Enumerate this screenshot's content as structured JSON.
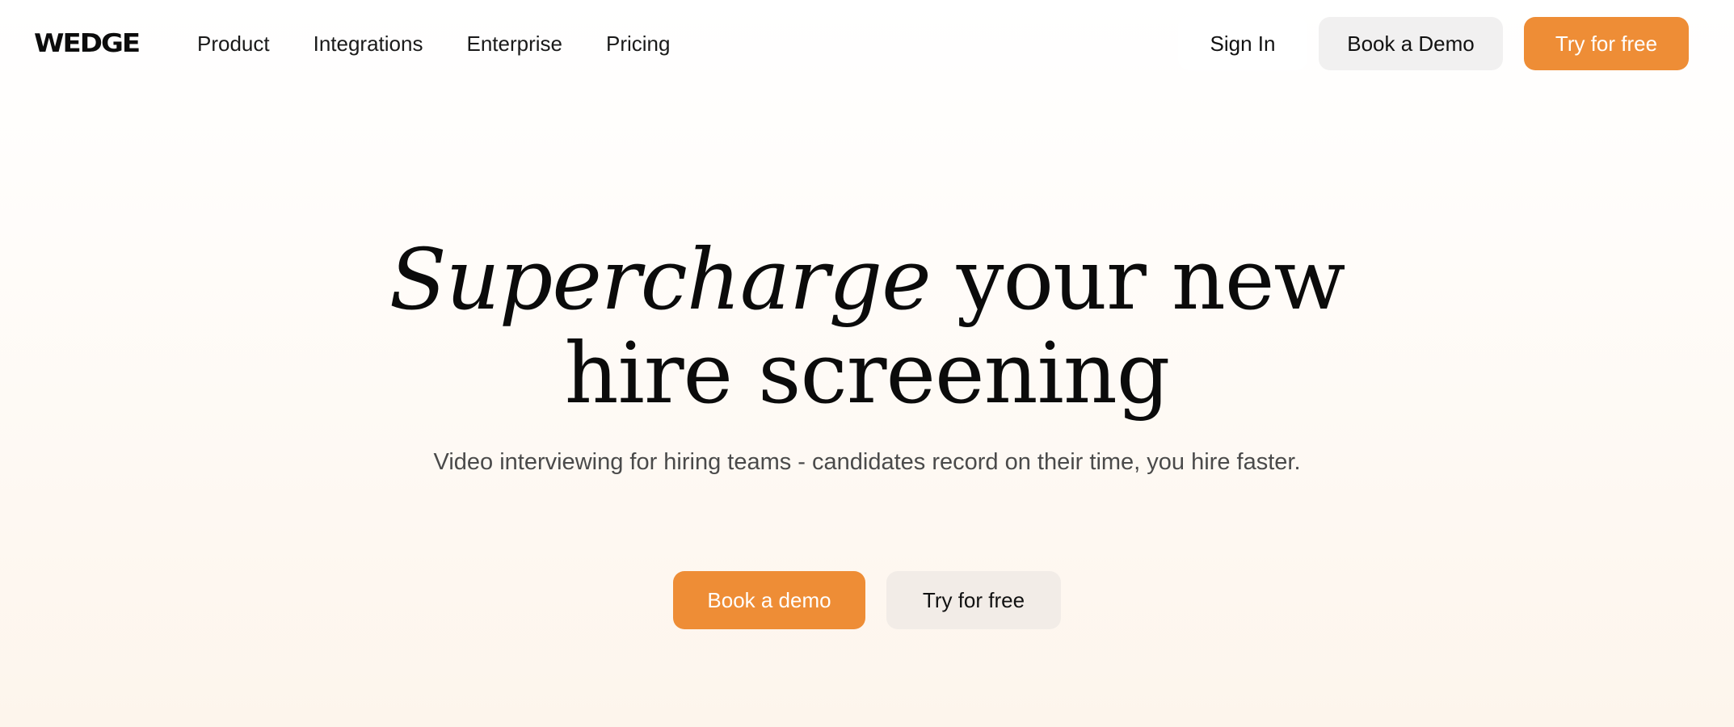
{
  "brand": {
    "logo_text": "WEDGE"
  },
  "nav": {
    "items": [
      {
        "label": "Product"
      },
      {
        "label": "Integrations"
      },
      {
        "label": "Enterprise"
      },
      {
        "label": "Pricing"
      }
    ]
  },
  "header_actions": {
    "sign_in": "Sign In",
    "book_demo": "Book a Demo",
    "try_free": "Try for free"
  },
  "hero": {
    "title_emphasis": "Supercharge",
    "title_line1_rest": " your new",
    "title_line2": "hire screening",
    "subtitle": "Video interviewing for hiring teams - candidates record on their time, you hire faster.",
    "cta_primary": "Book a demo",
    "cta_secondary": "Try for free"
  },
  "colors": {
    "accent": "#ee8d36",
    "secondary_button": "#f1f0f0",
    "text": "#111111",
    "subtitle_text": "#4a4a4a"
  }
}
